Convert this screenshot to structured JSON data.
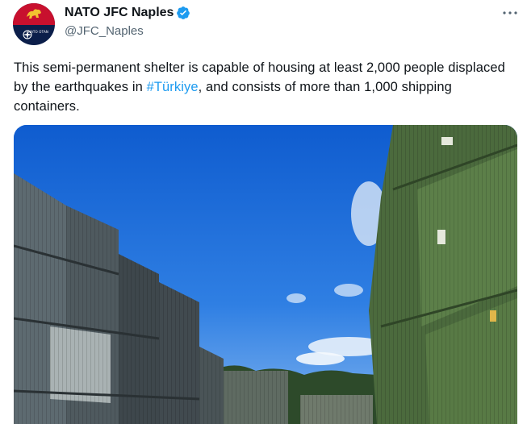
{
  "tweet": {
    "author": {
      "display_name": "NATO JFC Naples",
      "handle": "@JFC_Naples",
      "avatar_caption": "NATO OTAN"
    },
    "text_segments": {
      "before_hashtag": "This semi-permanent shelter is capable of housing at least 2,000 people displaced by the earthquakes in ",
      "hashtag": "#Türkiye",
      "after_hashtag": ", and consists of more than 1,000 shipping containers."
    },
    "more_label": "···",
    "media": {
      "icon": "photo",
      "subject": "stacked shipping containers under blue sky"
    },
    "colors": {
      "hashtag": "#1d9bf0",
      "verified": "#1d9bf0",
      "text": "#0f1419",
      "secondary": "#536471"
    }
  }
}
